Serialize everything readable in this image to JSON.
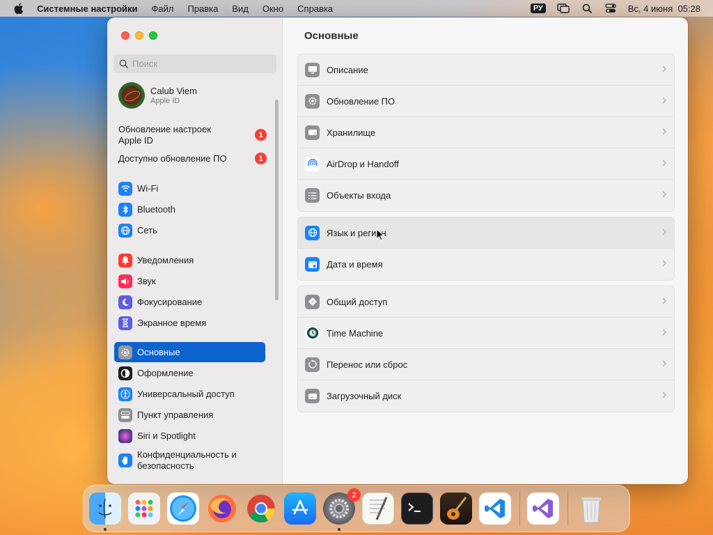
{
  "menubar": {
    "app_name": "Системные настройки",
    "items": [
      "Файл",
      "Правка",
      "Вид",
      "Окно",
      "Справка"
    ],
    "input_language": "РУ",
    "datetime": "Вс, 4 июня  05:28"
  },
  "sidebar": {
    "search_placeholder": "Поиск",
    "profile": {
      "name": "Calub Viem",
      "subtitle": "Apple ID"
    },
    "notices": [
      {
        "label": "Обновление настроек Apple ID",
        "badge": "1"
      },
      {
        "label": "Доступно обновление ПО",
        "badge": "1"
      }
    ],
    "items": [
      {
        "label": "Wi-Fi",
        "icon": "wifi-icon",
        "color": "#1a82fb"
      },
      {
        "label": "Bluetooth",
        "icon": "bluetooth-icon",
        "color": "#1a82fb"
      },
      {
        "label": "Сеть",
        "icon": "globe-icon",
        "color": "#1a82fb"
      },
      {
        "label": "Уведомления",
        "icon": "bell-icon",
        "color": "#ff3b30"
      },
      {
        "label": "Звук",
        "icon": "speaker-icon",
        "color": "#ff2d55"
      },
      {
        "label": "Фокусирование",
        "icon": "moon-icon",
        "color": "#5e5ce6"
      },
      {
        "label": "Экранное время",
        "icon": "hourglass-icon",
        "color": "#5e5ce6"
      },
      {
        "label": "Основные",
        "icon": "gear-icon",
        "color": "#8e8e93",
        "selected": true
      },
      {
        "label": "Оформление",
        "icon": "appearance-icon",
        "color": "#1d1d1f"
      },
      {
        "label": "Универсальный доступ",
        "icon": "accessibility-icon",
        "color": "#1a82fb"
      },
      {
        "label": "Пункт управления",
        "icon": "control-center-icon",
        "color": "#8e8e93"
      },
      {
        "label": "Siri и Spotlight",
        "icon": "siri-icon",
        "color": "#6b3fa0"
      },
      {
        "label": "Конфиденциальность и безопасность",
        "icon": "hand-icon",
        "color": "#1a82fb"
      }
    ]
  },
  "content": {
    "title": "Основные",
    "groups": [
      [
        {
          "label": "Описание",
          "icon": "display-icon"
        },
        {
          "label": "Обновление ПО",
          "icon": "gear-badge-icon"
        },
        {
          "label": "Хранилище",
          "icon": "drive-icon"
        },
        {
          "label": "AirDrop и Handoff",
          "icon": "airdrop-icon"
        },
        {
          "label": "Объекты входа",
          "icon": "list-icon"
        }
      ],
      [
        {
          "label": "Язык и регион",
          "icon": "globe-icon",
          "hover": true
        },
        {
          "label": "Дата и время",
          "icon": "calendar-clock-icon"
        }
      ],
      [
        {
          "label": "Общий доступ",
          "icon": "sharing-icon"
        },
        {
          "label": "Time Machine",
          "icon": "time-machine-icon"
        },
        {
          "label": "Перенос или сброс",
          "icon": "reset-icon"
        },
        {
          "label": "Загрузочный диск",
          "icon": "disk-icon"
        }
      ]
    ]
  },
  "dock": {
    "apps": [
      {
        "name": "Finder",
        "running": true
      },
      {
        "name": "Launchpad",
        "running": false
      },
      {
        "name": "Safari",
        "running": false
      },
      {
        "name": "Firefox",
        "running": false
      },
      {
        "name": "Chrome",
        "running": false
      },
      {
        "name": "App Store",
        "running": false
      },
      {
        "name": "System Settings",
        "running": true,
        "badge": "2"
      },
      {
        "name": "TextEdit",
        "running": false
      },
      {
        "name": "Terminal",
        "running": false
      },
      {
        "name": "GarageBand",
        "running": false
      },
      {
        "name": "VS Code",
        "running": false
      },
      {
        "name": "Visual Studio",
        "running": false
      },
      {
        "name": "Trash",
        "running": false
      }
    ]
  }
}
